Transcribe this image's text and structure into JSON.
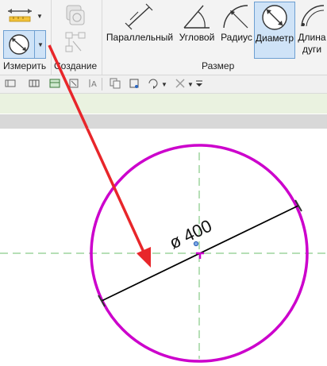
{
  "ribbon": {
    "measure_panel_label": "Измерить",
    "create_panel_label": "Создание",
    "dimension_panel_label": "Размер",
    "buttons": {
      "aligned": "Параллельный",
      "angular": "Угловой",
      "radial": "Радиус",
      "diameter": "Диаметр",
      "arc_length_line1": "Длина",
      "arc_length_line2": "дуги"
    }
  },
  "canvas": {
    "dimension_text": "ø 400",
    "circle_color": "#cc00cc",
    "annotation_arrow_color": "#e8262a",
    "dimension_line_color": "#000000",
    "guide_color": "#6dbf6d"
  },
  "icons": [
    "measure-ruler-icon",
    "measure-circle-icon",
    "create-similar-icon",
    "create-component-icon",
    "aligned-dimension-icon",
    "angular-dimension-icon",
    "radial-dimension-icon",
    "diameter-dimension-icon",
    "arc-length-dimension-icon"
  ]
}
